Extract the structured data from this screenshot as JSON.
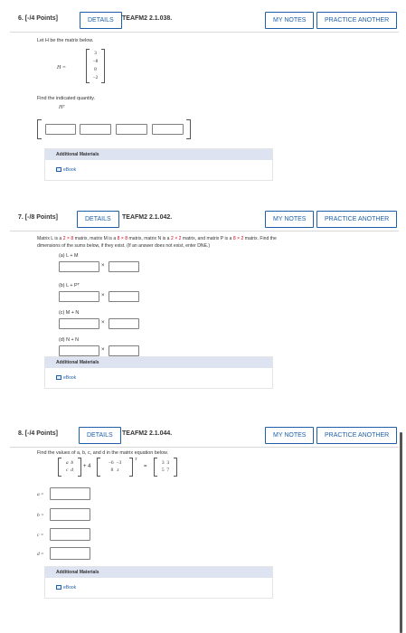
{
  "q6": {
    "num": "6. [-/4 Points]",
    "details": "DETAILS",
    "code": "TEAFM2 2.1.038.",
    "my_notes": "MY NOTES",
    "practice": "PRACTICE ANOTHER",
    "intro": "Let H be the matrix below.",
    "h_label": "H =",
    "h_values": [
      "3",
      "−8",
      "8",
      "−2"
    ],
    "find": "Find the indicated quantity.",
    "quantity": "Hᵀ",
    "addl": "Additional Materials",
    "ebook": "eBook"
  },
  "q7": {
    "num": "7. [-/8 Points]",
    "details": "DETAILS",
    "code": "TEAFM2 2.1.042.",
    "my_notes": "MY NOTES",
    "practice": "PRACTICE ANOTHER",
    "line1": {
      "a": "Matrix L is a ",
      "b": "2",
      "c": " × ",
      "d": "8",
      "e": " matrix, matrix M is a ",
      "f": "8",
      "g": " × ",
      "h": "8",
      "i": " matrix, matrix N is a ",
      "j": "2",
      "k": " × ",
      "l": "2",
      "m": " matrix, and matrix P is a ",
      "n": "8",
      "o": " × ",
      "p": "2",
      "q": " matrix. Find the"
    },
    "line2": "dimensions of the sums below, if they exist. (If an answer does not exist, enter DNE.)",
    "parts": [
      "(a) L + M",
      "(b) L + Pᵀ",
      "(c) M + N",
      "(d) N + N"
    ],
    "times": "×",
    "addl": "Additional Materials",
    "ebook": "eBook"
  },
  "q8": {
    "num": "8. [-/4 Points]",
    "details": "DETAILS",
    "code": "TEAFM2 2.1.044.",
    "my_notes": "MY NOTES",
    "practice": "PRACTICE ANOTHER",
    "intro": "Find the values of a, b, c, and d in the matrix equation below.",
    "m1": [
      "a",
      "b",
      "c",
      "d"
    ],
    "plus4": "+ 4",
    "m2": [
      "−6",
      "−3",
      "8",
      "z"
    ],
    "sup_t": "T",
    "equals": "=",
    "m3": [
      "3",
      "3",
      "5",
      "7"
    ],
    "vars": [
      "a =",
      "b =",
      "c =",
      "d ="
    ],
    "addl": "Additional Materials",
    "ebook": "eBook"
  }
}
